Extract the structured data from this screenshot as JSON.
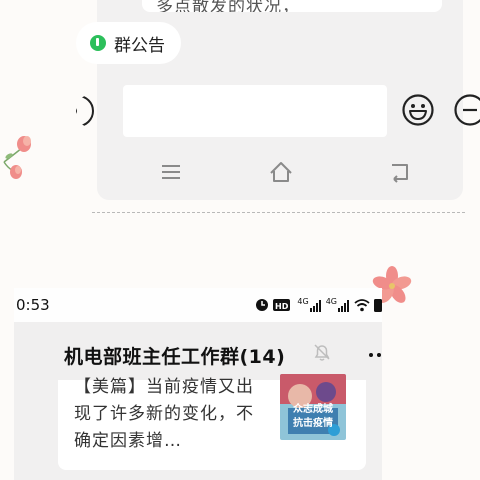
{
  "top_screenshot": {
    "message_partial": "多点散发的状况，",
    "group_notice_label": "群公告",
    "input_value": "",
    "icons": {
      "notice": "notice-icon",
      "voice": "voice-icon",
      "emoji": "smiley-icon",
      "add": "add-icon",
      "nav_menu": "menu-icon",
      "nav_home": "home-icon",
      "nav_back": "back-icon"
    }
  },
  "bottom_screenshot": {
    "status_bar": {
      "time": "0:53",
      "network_1": "4G",
      "network_2": "4G"
    },
    "chat_title": "机电部班主任工作群(14)",
    "article": {
      "text": "【美篇】当前疫情又出现了许多新的变化，不确定因素增…",
      "thumb_caption_1": "众志成城",
      "thumb_caption_2": "抗击疫情"
    }
  },
  "colors": {
    "accent_green": "#2cbf5b",
    "flower_pink": "#f08d8a",
    "chat_background": "#f1f0f0"
  }
}
